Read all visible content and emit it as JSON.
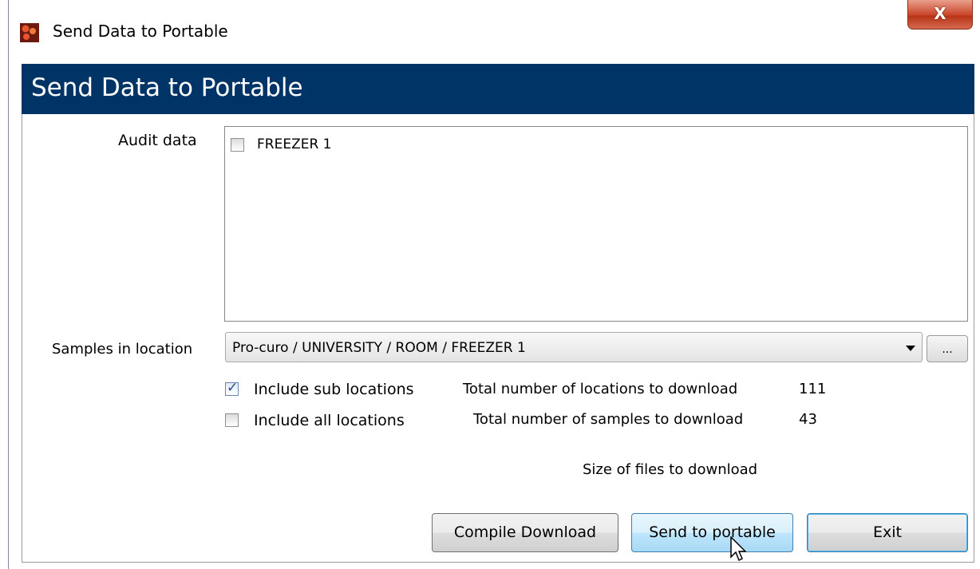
{
  "window": {
    "title": "Send Data to Portable",
    "close_glyph": "X"
  },
  "header": {
    "title": "Send Data to Portable",
    "color": "#003366"
  },
  "audit": {
    "label": "Audit data",
    "items": [
      {
        "label": "FREEZER 1",
        "checked": false
      }
    ]
  },
  "location": {
    "label": "Samples in location",
    "selected": "Pro-curo / UNIVERSITY / ROOM / FREEZER 1",
    "browse_label": "..."
  },
  "options": {
    "include_sub": {
      "label": "Include sub locations",
      "checked": true
    },
    "include_all": {
      "label": "Include all locations",
      "checked": false
    }
  },
  "stats": {
    "locations_label": "Total number of locations to download",
    "locations_value": "111",
    "samples_label": "Total number of samples to download",
    "samples_value": "43",
    "size_label": "Size of files to download",
    "size_value": ""
  },
  "buttons": {
    "compile": "Compile Download",
    "send": "Send to portable",
    "exit": "Exit"
  }
}
